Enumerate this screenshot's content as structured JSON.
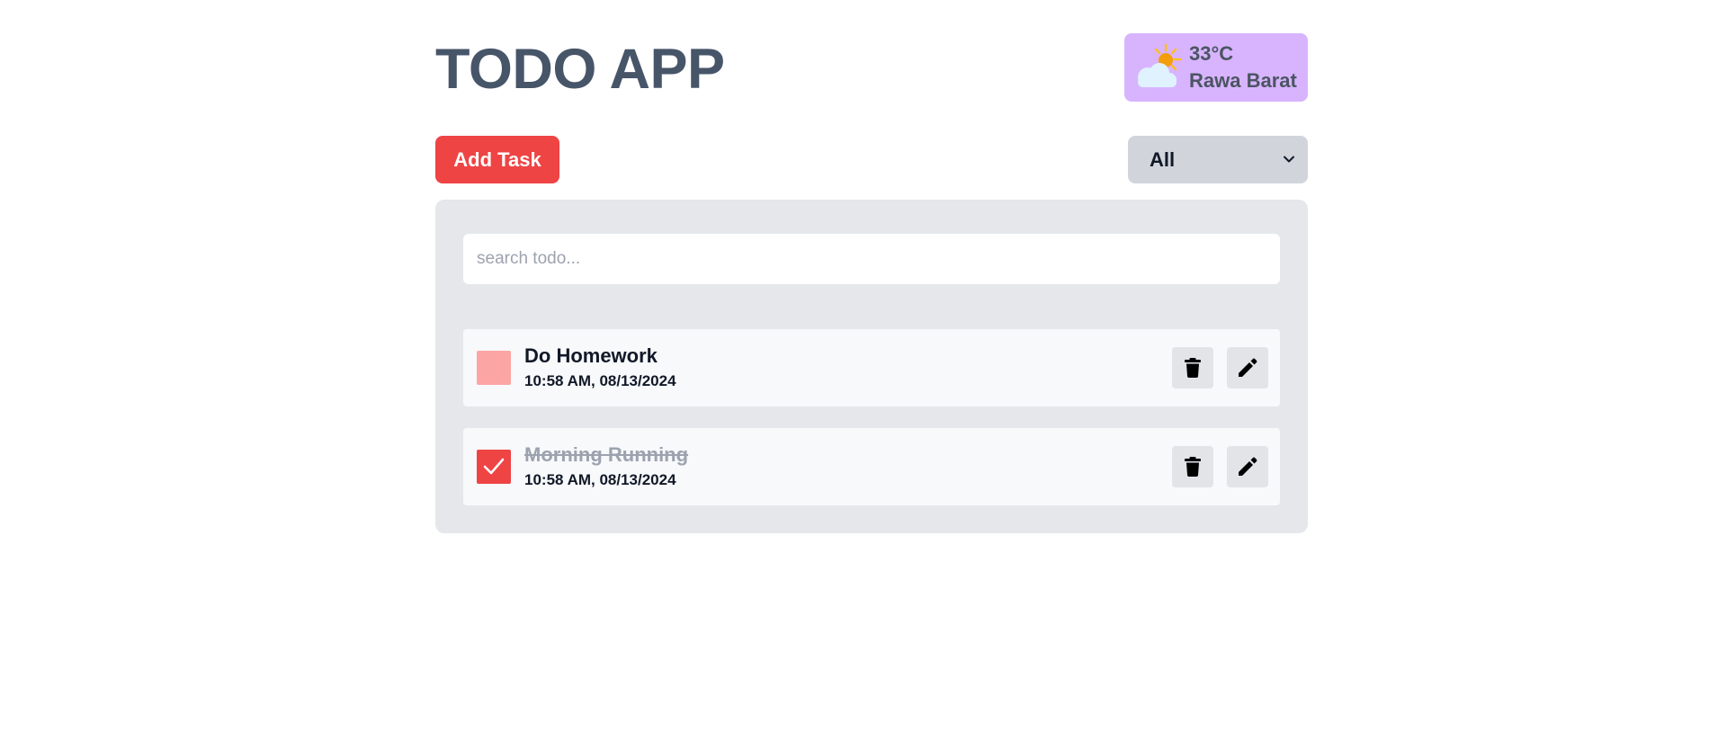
{
  "app": {
    "title": "TODO APP"
  },
  "weather": {
    "icon": "partly-cloudy-sun-icon",
    "temperature": "33°C",
    "location": "Rawa Barat",
    "background": "#d8b4fe"
  },
  "toolbar": {
    "add_label": "Add Task",
    "filter": {
      "selected": "All"
    }
  },
  "search": {
    "placeholder": "search todo...",
    "value": ""
  },
  "todos": [
    {
      "title": "Do Homework",
      "time": "10:58 AM, 08/13/2024",
      "completed": false
    },
    {
      "title": "Morning Running",
      "time": "10:58 AM, 08/13/2024",
      "completed": true
    }
  ],
  "icons": {
    "delete": "trash-icon",
    "edit": "pencil-icon",
    "check": "checkmark-icon",
    "chevron": "chevron-down-icon"
  },
  "colors": {
    "accent": "#ef4444",
    "accent_light": "#fca5a5",
    "title": "#475569",
    "panel": "#e5e7eb",
    "item": "#f8f9fb"
  }
}
